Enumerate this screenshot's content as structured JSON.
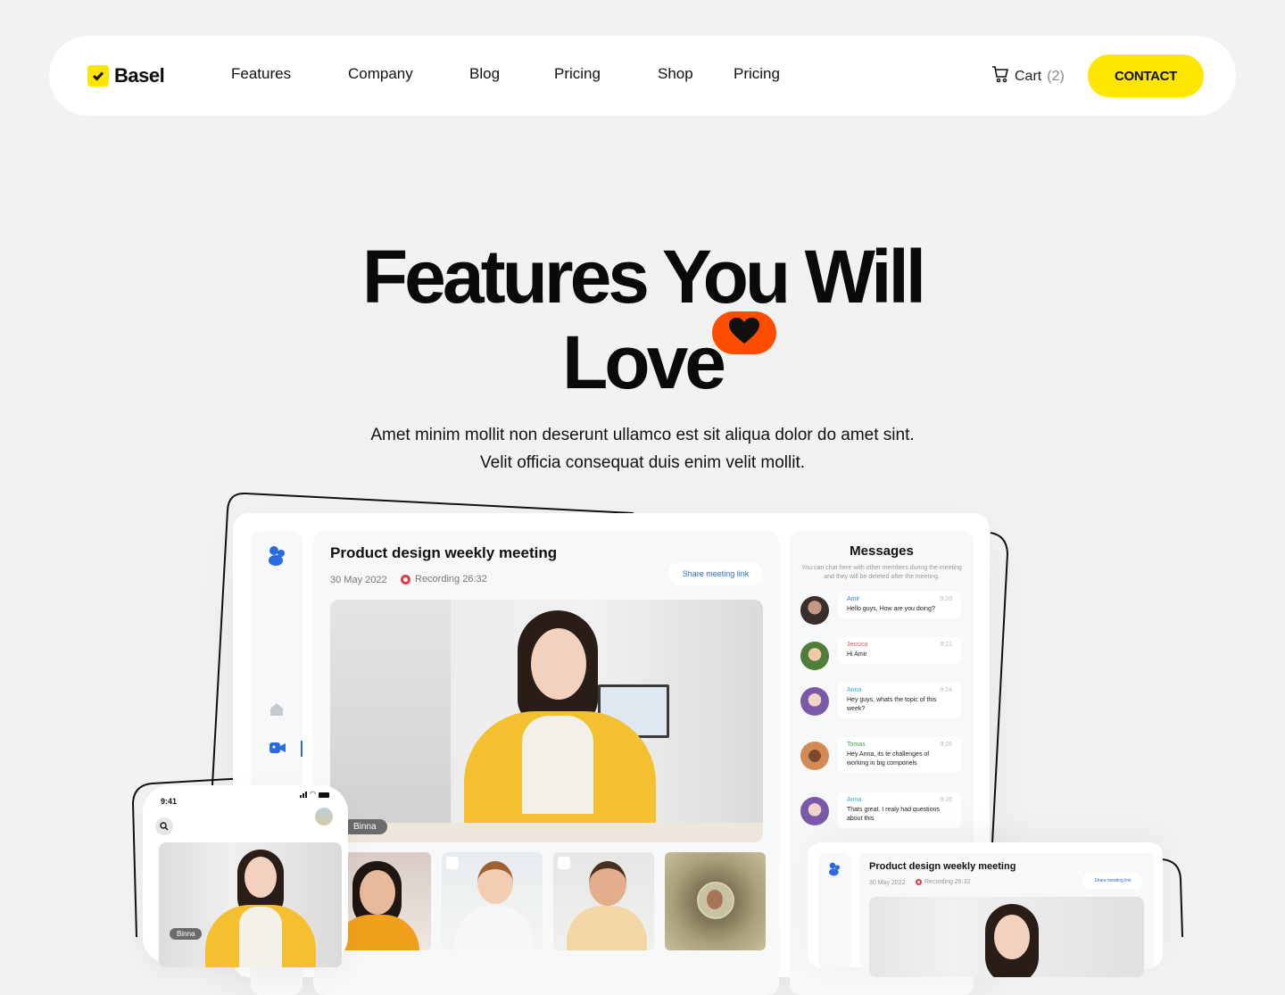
{
  "nav": {
    "brand": "Basel",
    "links": [
      "Features",
      "Company",
      "Blog",
      "Pricing",
      "Shop",
      "Pricing"
    ],
    "cart_label": "Cart",
    "cart_count": "(2)",
    "contact_label": "CONTACT",
    "accent": "#ffe600"
  },
  "hero": {
    "title_line1": "Features You Will",
    "title_line2": "Love",
    "badge_color": "#ff4d00",
    "subtitle_line1": "Amet minim mollit non deserunt ullamco est sit aliqua dolor do amet sint.",
    "subtitle_line2": "Velit officia consequat duis enim velit mollit."
  },
  "meeting": {
    "title": "Product design weekly meeting",
    "date": "30 May 2022",
    "recording": "Recording 26:32",
    "share_label": "Share meeting link",
    "speaker": "Binna"
  },
  "messages": {
    "title": "Messages",
    "description": "You can chat here with other members during the meeting and they will be deleted after the meeting.",
    "items": [
      {
        "name": "Amir",
        "time": "9:20",
        "text": "Hello guys, How are you doing?",
        "color": "#3b7be0"
      },
      {
        "name": "Jessica",
        "time": "9:21",
        "text": "Hi Amir",
        "color": "#e5566a"
      },
      {
        "name": "Anna",
        "time": "9:24",
        "text": "Hey guys, whats the topic of this week?",
        "color": "#2bb3c0"
      },
      {
        "name": "Tomas",
        "time": "9:26",
        "text": "Hey Anna, its te challenges of working in big componels",
        "color": "#3aa84a"
      },
      {
        "name": "Anna",
        "time": "9:26",
        "text": "Thats great. I realy had questions about this",
        "color": "#2bb3c0"
      }
    ]
  },
  "phone": {
    "time": "9:41",
    "speaker": "Binna"
  },
  "mini": {
    "title": "Product design weekly meeting",
    "date": "30 May 2022",
    "recording": "Recording 26:32",
    "share_label": "Share meeting link"
  }
}
